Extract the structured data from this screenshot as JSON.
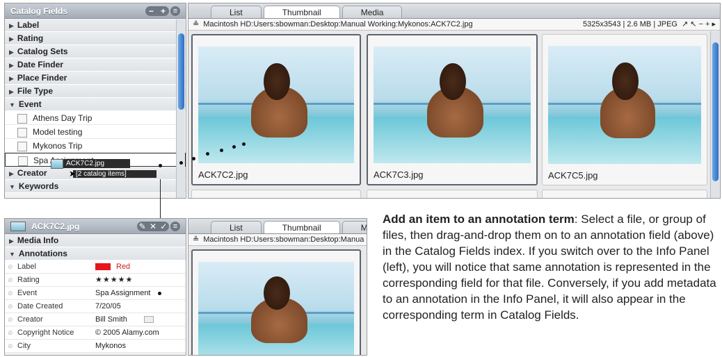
{
  "catalog_panel": {
    "title": "Catalog Fields",
    "ctrl_minus": "−",
    "ctrl_plus": "+",
    "ctrl_menu": "≡",
    "fields": [
      "Label",
      "Rating",
      "Catalog Sets",
      "Date Finder",
      "Place Finder",
      "File Type"
    ],
    "event_label": "Event",
    "terms": [
      "Athens Day Trip",
      "Model testing",
      "Mykonos Trip",
      "Spa Assignment"
    ],
    "creator_label": "Creator",
    "keywords_label": "Keywords",
    "drag_file": "ACK7C2.jpg",
    "drag_count": "[2 catalog items]"
  },
  "browser_top": {
    "tabs": [
      "List",
      "Thumbnail",
      "Media"
    ],
    "path": "Macintosh HD:Users:sbowman:Desktop:Manual Working:Mykonos:ACK7C2.jpg",
    "meta": "5325x3543  |  2.6 MB  |  JPEG",
    "thumbs": [
      "ACK7C2.jpg",
      "ACK7C3.jpg",
      "ACK7C5.jpg"
    ]
  },
  "info_panel": {
    "title": "ACK7C2.jpg",
    "media_info_label": "Media Info",
    "annotations_label": "Annotations",
    "rows": [
      {
        "key": "Label",
        "value": "Red"
      },
      {
        "key": "Rating",
        "value": "★★★★★"
      },
      {
        "key": "Event",
        "value": "Spa Assignment"
      },
      {
        "key": "Date Created",
        "value": "7/20/05"
      },
      {
        "key": "Creator",
        "value": "Bill Smith"
      },
      {
        "key": "Copyright Notice",
        "value": "© 2005 Alamy.com"
      },
      {
        "key": "City",
        "value": "Mykonos"
      }
    ],
    "label_color": "#e8141c"
  },
  "browser_bottom": {
    "tabs": [
      "List",
      "Thumbnail",
      "Media"
    ],
    "path": "Macintosh HD:Users:sbowman:Desktop:Manua"
  },
  "caption": {
    "heading": "Add an item to an annotation term",
    "body": ": Select a file, or group of files, then drag-and-drop them on to an annotation field (above) in the Catalog Fields index. If you switch over to the Info Panel (left), you will notice that same annotation is represented in the corresponding field for that file. Conversely, if you add metadata to an annotation in the Info Panel, it will also appear in the corresponding term in Catalog Fields."
  }
}
